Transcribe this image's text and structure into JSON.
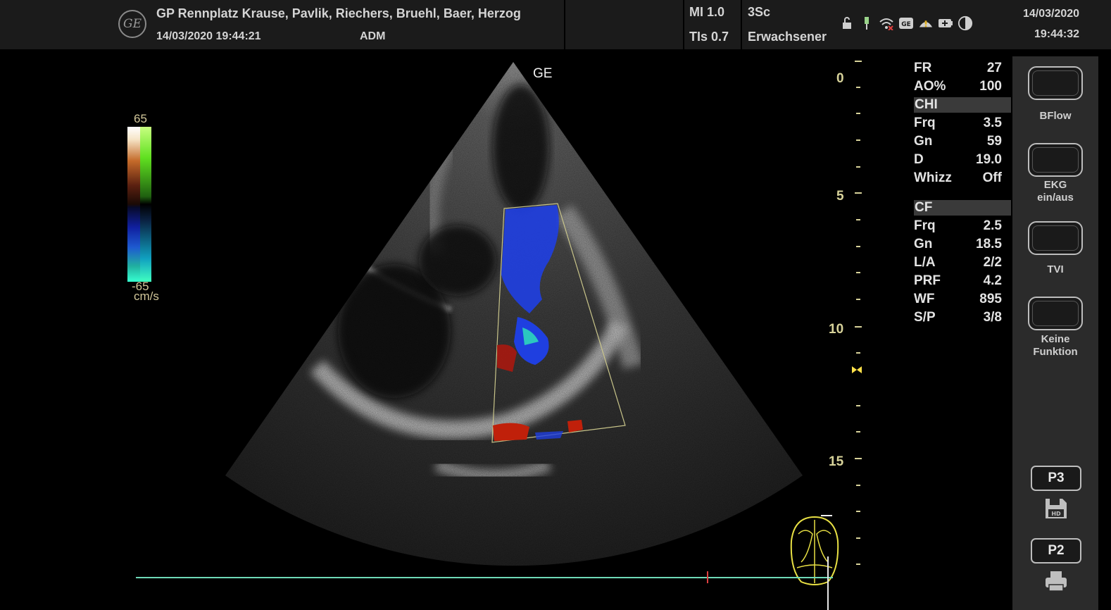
{
  "header": {
    "institution": "GP Rennplatz Krause, Pavlik, Riechers, Bruehl, Baer, Herzog",
    "exam_datetime": "14/03/2020 19:44:21",
    "operator": "ADM",
    "mi": "MI 1.0",
    "tis": "TIs 0.7",
    "probe": "3Sc",
    "preset": "Erwachsener",
    "date": "14/03/2020",
    "time": "19:44:32",
    "logo_text": "GE",
    "status_icons": [
      "lock-icon",
      "usb-icon",
      "wifi-icon",
      "ge-service-icon",
      "warning-icon",
      "battery-icon",
      "contrast-icon"
    ]
  },
  "image": {
    "probe_mark": "GE",
    "colorbar": {
      "max": "65",
      "min": "-65",
      "unit": "cm/s"
    },
    "depth_labels": [
      "0",
      "5",
      "10",
      "15"
    ]
  },
  "params": {
    "general": [
      {
        "label": "FR",
        "value": "27"
      },
      {
        "label": "AO%",
        "value": "100"
      }
    ],
    "chi_title": "CHI",
    "chi": [
      {
        "label": "Frq",
        "value": "3.5"
      },
      {
        "label": "Gn",
        "value": "59"
      },
      {
        "label": "D",
        "value": "19.0"
      },
      {
        "label": "Whizz",
        "value": "Off"
      }
    ],
    "cf_title": "CF",
    "cf": [
      {
        "label": "Frq",
        "value": "2.5"
      },
      {
        "label": "Gn",
        "value": "18.5"
      },
      {
        "label": "L/A",
        "value": "2/2"
      },
      {
        "label": "PRF",
        "value": "4.2"
      },
      {
        "label": "WF",
        "value": "895"
      },
      {
        "label": "S/P",
        "value": "3/8"
      }
    ]
  },
  "sidebar": {
    "buttons": [
      {
        "label": "BFlow"
      },
      {
        "label": "EKG\nein/aus"
      },
      {
        "label": "TVI"
      },
      {
        "label": "Keine\nFunktion"
      }
    ],
    "p3": "P3",
    "p3_icon_text": "HD",
    "p2": "P2"
  },
  "colors": {
    "header_bg": "#1b1b1b",
    "sidebar_bg": "#2b2b2b",
    "depth_scale": "#d8d39a",
    "ecg_trace": "#6fd9b8",
    "doppler_blue": "#1f3fe0",
    "doppler_red": "#c0200a"
  }
}
